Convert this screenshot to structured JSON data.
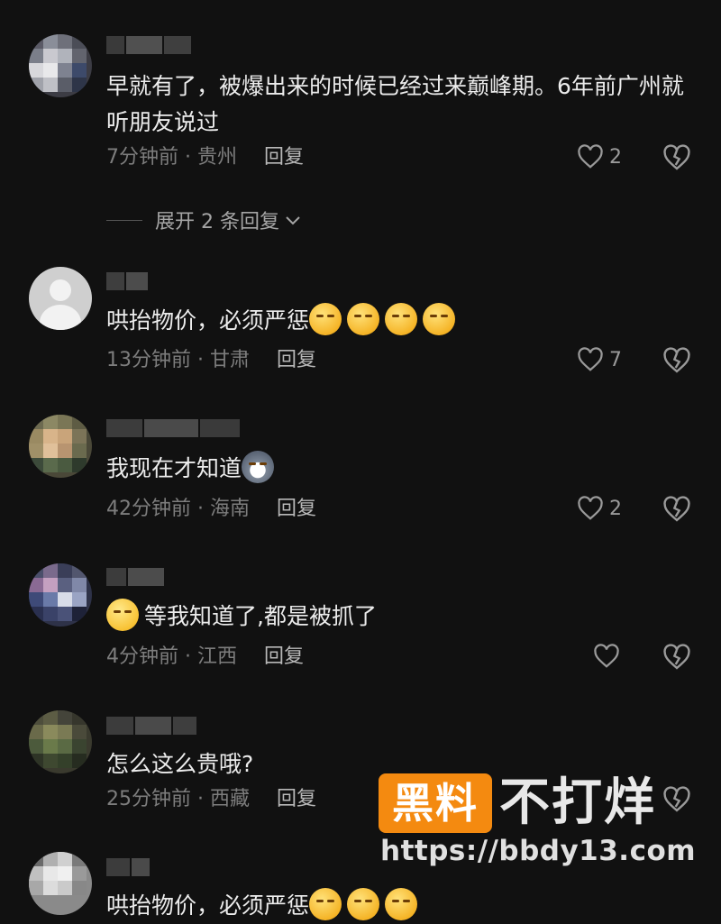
{
  "comments": [
    {
      "text": "早就有了，被爆出来的时候已经过来巅峰期。6年前广州就听朋友说过",
      "time": "7分钟前",
      "location": "贵州",
      "reply_label": "回复",
      "likes": "2"
    },
    {
      "text": "哄抬物价，必须严惩",
      "emojis": [
        "sleeping-face",
        "sleeping-face",
        "sleeping-face",
        "sleeping-face"
      ],
      "time": "13分钟前",
      "location": "甘肃",
      "reply_label": "回复",
      "likes": "7"
    },
    {
      "text": "我现在才知道",
      "emojis": [
        "husky-dog"
      ],
      "time": "42分钟前",
      "location": "海南",
      "reply_label": "回复",
      "likes": "2"
    },
    {
      "text": "等我知道了,都是被抓了",
      "emojis": [
        "grinning-sweat-face"
      ],
      "time": "4分钟前",
      "location": "江西",
      "reply_label": "回复",
      "likes": ""
    },
    {
      "text": "怎么这么贵哦?",
      "time": "25分钟前",
      "location": "西藏",
      "reply_label": "回复",
      "likes": ""
    },
    {
      "text": "哄抬物价，必须严惩",
      "emojis": [
        "sleeping-face",
        "sleeping-face",
        "sleeping-face"
      ]
    }
  ],
  "expand_replies": "展开 2 条回复",
  "meta_separator": " · ",
  "watermark": {
    "badge": "黑料",
    "name": "不打烊",
    "url": "https://bbdy13.com"
  },
  "colors": {
    "background": "#111111",
    "text": "#ececec",
    "meta": "#7d7d7d",
    "watermark_orange": "#f48a10"
  },
  "icons": [
    "heart-outline-icon",
    "broken-heart-icon",
    "chevron-down-icon"
  ]
}
